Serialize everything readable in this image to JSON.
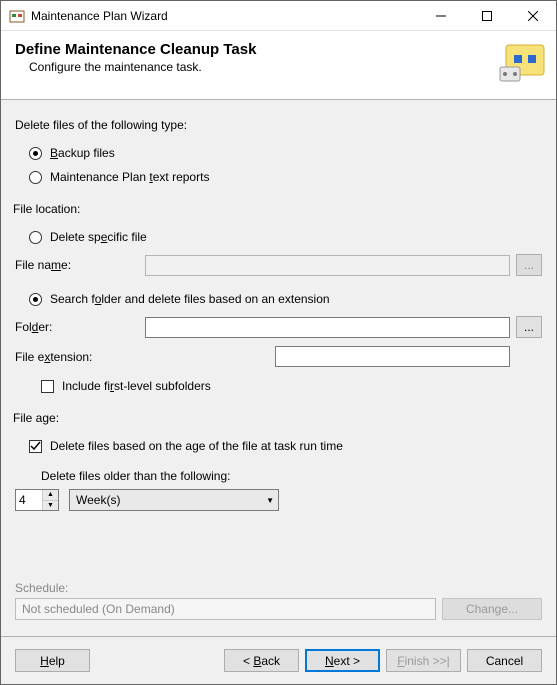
{
  "window": {
    "title": "Maintenance Plan Wizard"
  },
  "header": {
    "title": "Define Maintenance Cleanup Task",
    "subtitle": "Configure the maintenance task."
  },
  "deleteType": {
    "label": "Delete files of the following type:",
    "backup": "Backup files",
    "reports": "Maintenance Plan text reports"
  },
  "fileLocation": {
    "label": "File location:",
    "specific": "Delete specific file",
    "filenameLabel": "File name:",
    "filenameValue": "",
    "search": "Search folder and delete files based on an extension",
    "folderLabel": "Folder:",
    "folderValue": "",
    "extLabel": "File extension:",
    "extValue": "",
    "includeSub": "Include first-level subfolders",
    "browse": "..."
  },
  "fileAge": {
    "label": "File age:",
    "deleteBasedOnAge": "Delete files based on the age of the file at task run time",
    "olderThan": "Delete files older than the following:",
    "number": "4",
    "unit": "Week(s)"
  },
  "schedule": {
    "label": "Schedule:",
    "value": "Not scheduled (On Demand)",
    "change": "Change..."
  },
  "buttons": {
    "help": "Help",
    "back": "< Back",
    "next": "Next >",
    "finish": "Finish >>|",
    "cancel": "Cancel"
  }
}
